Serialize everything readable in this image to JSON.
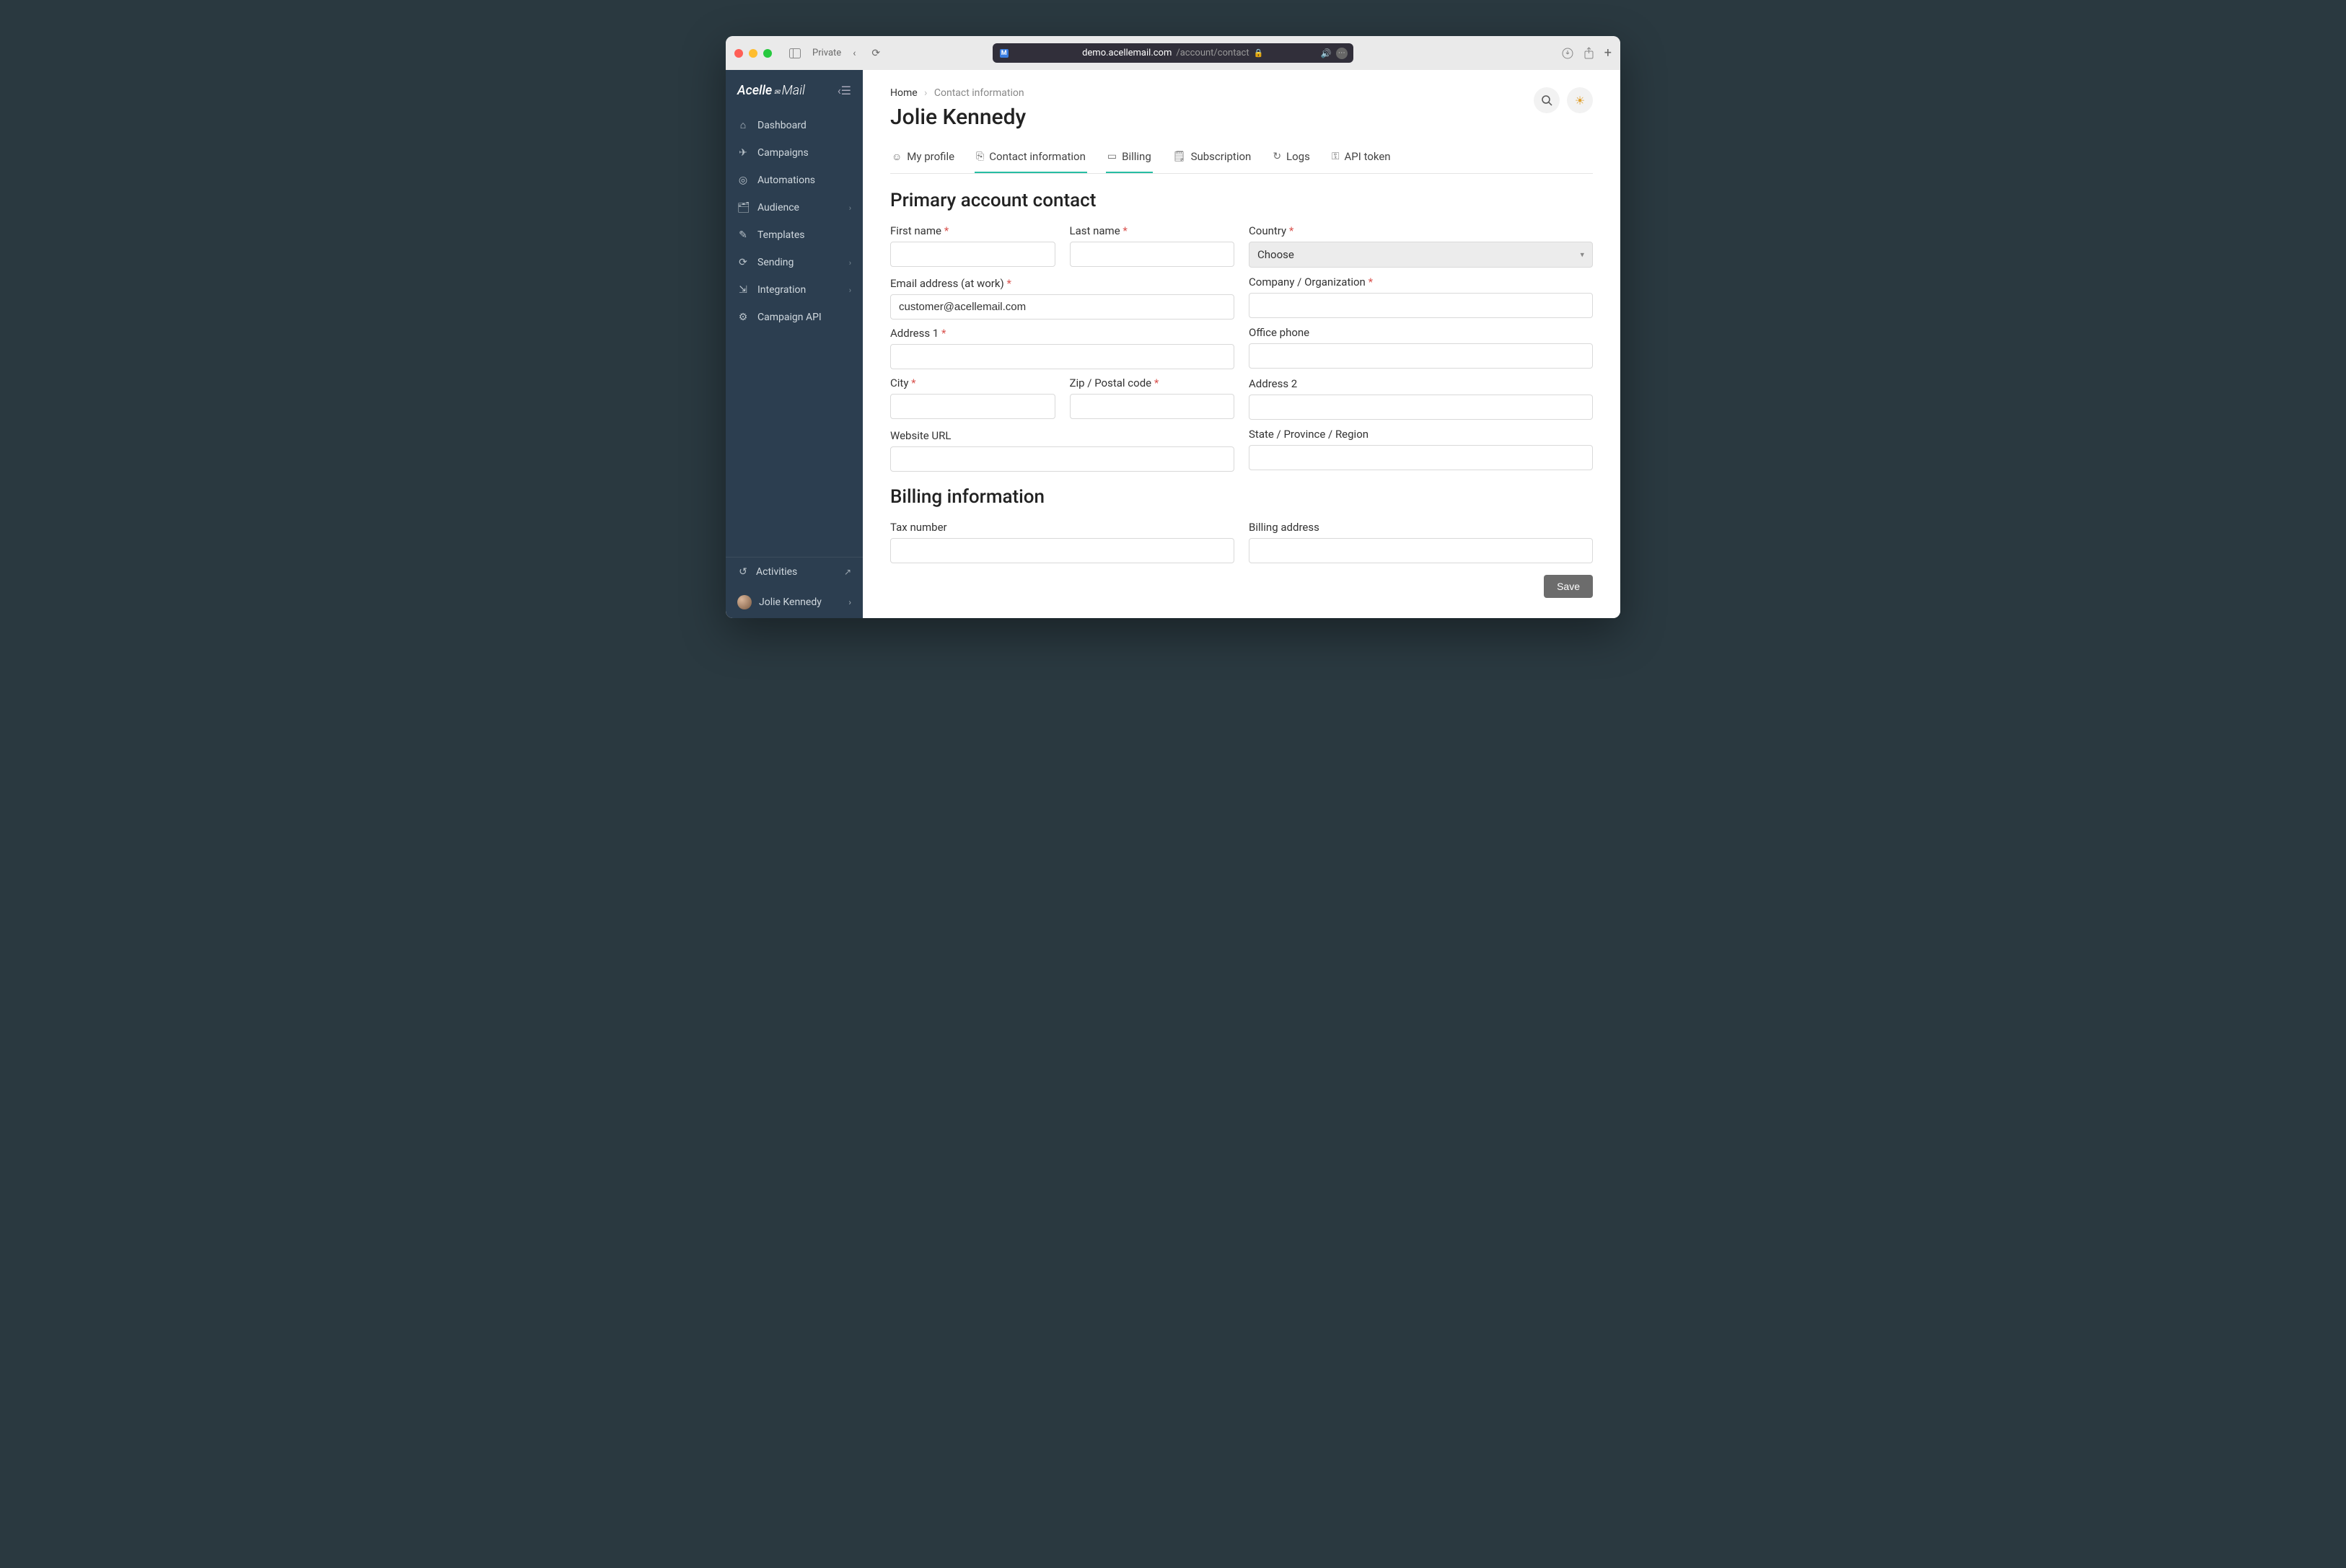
{
  "browser": {
    "private_label": "Private",
    "url_domain": "demo.acellemail.com",
    "url_path": "/account/contact"
  },
  "sidebar": {
    "logo": "Acelle",
    "logo_suffix": "Mail",
    "items": [
      {
        "label": "Dashboard",
        "icon": "⌂",
        "expandable": false
      },
      {
        "label": "Campaigns",
        "icon": "✈",
        "expandable": false
      },
      {
        "label": "Automations",
        "icon": "◎",
        "expandable": false
      },
      {
        "label": "Audience",
        "icon": "🗂",
        "expandable": true
      },
      {
        "label": "Templates",
        "icon": "✎",
        "expandable": false
      },
      {
        "label": "Sending",
        "icon": "⟳",
        "expandable": true
      },
      {
        "label": "Integration",
        "icon": "⇲",
        "expandable": true
      },
      {
        "label": "Campaign API",
        "icon": "⚙",
        "expandable": false
      }
    ],
    "activities_label": "Activities",
    "user_name": "Jolie Kennedy"
  },
  "breadcrumb": {
    "home": "Home",
    "current": "Contact information"
  },
  "page": {
    "title": "Jolie Kennedy"
  },
  "tabs": [
    {
      "label": "My profile",
      "icon": "☺"
    },
    {
      "label": "Contact information",
      "icon": "⎘",
      "active": true
    },
    {
      "label": "Billing",
      "icon": "▭",
      "active": true
    },
    {
      "label": "Subscription",
      "icon": "🗒"
    },
    {
      "label": "Logs",
      "icon": "↻"
    },
    {
      "label": "API token",
      "icon": "⚿"
    }
  ],
  "sections": {
    "primary_title": "Primary account contact",
    "billing_title": "Billing information"
  },
  "form": {
    "first_name": {
      "label": "First name",
      "required": true,
      "value": ""
    },
    "last_name": {
      "label": "Last name",
      "required": true,
      "value": ""
    },
    "country": {
      "label": "Country",
      "required": true,
      "selected": "Choose"
    },
    "email": {
      "label": "Email address (at work)",
      "required": true,
      "value": "customer@acellemail.com"
    },
    "company": {
      "label": "Company / Organization",
      "required": true,
      "value": ""
    },
    "address1": {
      "label": "Address 1",
      "required": true,
      "value": ""
    },
    "office_phone": {
      "label": "Office phone",
      "required": false,
      "value": ""
    },
    "city": {
      "label": "City",
      "required": true,
      "value": ""
    },
    "zip": {
      "label": "Zip / Postal code",
      "required": true,
      "value": ""
    },
    "address2": {
      "label": "Address 2",
      "required": false,
      "value": ""
    },
    "website": {
      "label": "Website URL",
      "required": false,
      "value": ""
    },
    "state": {
      "label": "State / Province / Region",
      "required": false,
      "value": ""
    },
    "tax": {
      "label": "Tax number",
      "required": false,
      "value": ""
    },
    "billing_address": {
      "label": "Billing address",
      "required": false,
      "value": ""
    }
  },
  "buttons": {
    "save": "Save"
  }
}
